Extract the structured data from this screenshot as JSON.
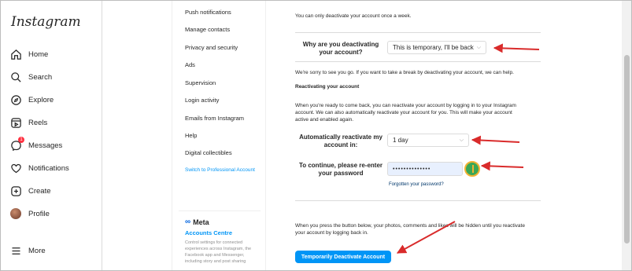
{
  "app": {
    "logo": "Instagram"
  },
  "nav": {
    "items": [
      {
        "label": "Home",
        "icon": "home-icon"
      },
      {
        "label": "Search",
        "icon": "search-icon"
      },
      {
        "label": "Explore",
        "icon": "compass-icon"
      },
      {
        "label": "Reels",
        "icon": "reels-icon"
      },
      {
        "label": "Messages",
        "icon": "messenger-icon",
        "badge": "1"
      },
      {
        "label": "Notifications",
        "icon": "heart-icon"
      },
      {
        "label": "Create",
        "icon": "plus-square-icon"
      },
      {
        "label": "Profile",
        "icon": "avatar"
      }
    ],
    "more": "More"
  },
  "settings": {
    "items": [
      "Push notifications",
      "Manage contacts",
      "Privacy and security",
      "Ads",
      "Supervision",
      "Login activity",
      "Emails from Instagram",
      "Help",
      "Digital collectibles",
      "Switch to Professional Account"
    ],
    "meta": {
      "logo": "Meta",
      "accounts_centre": "Accounts Centre",
      "description": "Control settings for connected experiences across Instagram, the Facebook app and Messenger, including story and post sharing"
    }
  },
  "main": {
    "once_week": "You can only deactivate your account once a week.",
    "why_label": "Why are you deactivating your account?",
    "why_value": "This is temporary, I'll be back",
    "sorry_text": "We're sorry to see you go. If you want to take a break by deactivating your account, we can help.",
    "reactivating_heading": "Reactivating your account",
    "reactivating_text": "When you're ready to come back, you can reactivate your account by logging in to your Instagram account. We can also automatically reactivate your account for you. This will make your account active and enabled again.",
    "auto_label": "Automatically reactivate my account in:",
    "auto_value": "1 day",
    "password_label": "To continue, please re-enter your password",
    "password_value": "••••••••••••••",
    "forgot_link": "Forgotten your password?",
    "bottom_text": "When you press the button below, your photos, comments and likes will be hidden until you reactivate your account by logging back in.",
    "button_label": "Temporarily Deactivate Account"
  },
  "colors": {
    "accent": "#0095f6",
    "annotation": "#d92b2b"
  }
}
